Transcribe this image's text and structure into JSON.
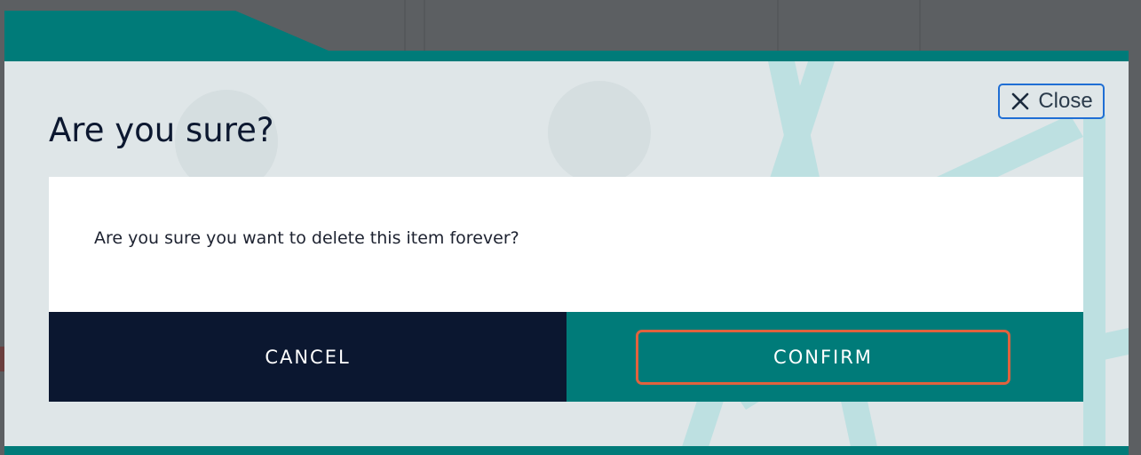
{
  "colors": {
    "backdrop": "#5c5f62",
    "teal": "#007b79",
    "navy": "#0b1730",
    "modal_bg": "#dfe6e8",
    "focus_outline": "#1f6ed4",
    "confirm_outline": "#e0623e"
  },
  "dialog": {
    "close": {
      "icon": "close-icon",
      "label": "Close"
    },
    "title": "Are you sure?",
    "message": "Are you sure you want to delete this item forever?",
    "cancel_label": "CANCEL",
    "confirm_label": "CONFIRM"
  }
}
